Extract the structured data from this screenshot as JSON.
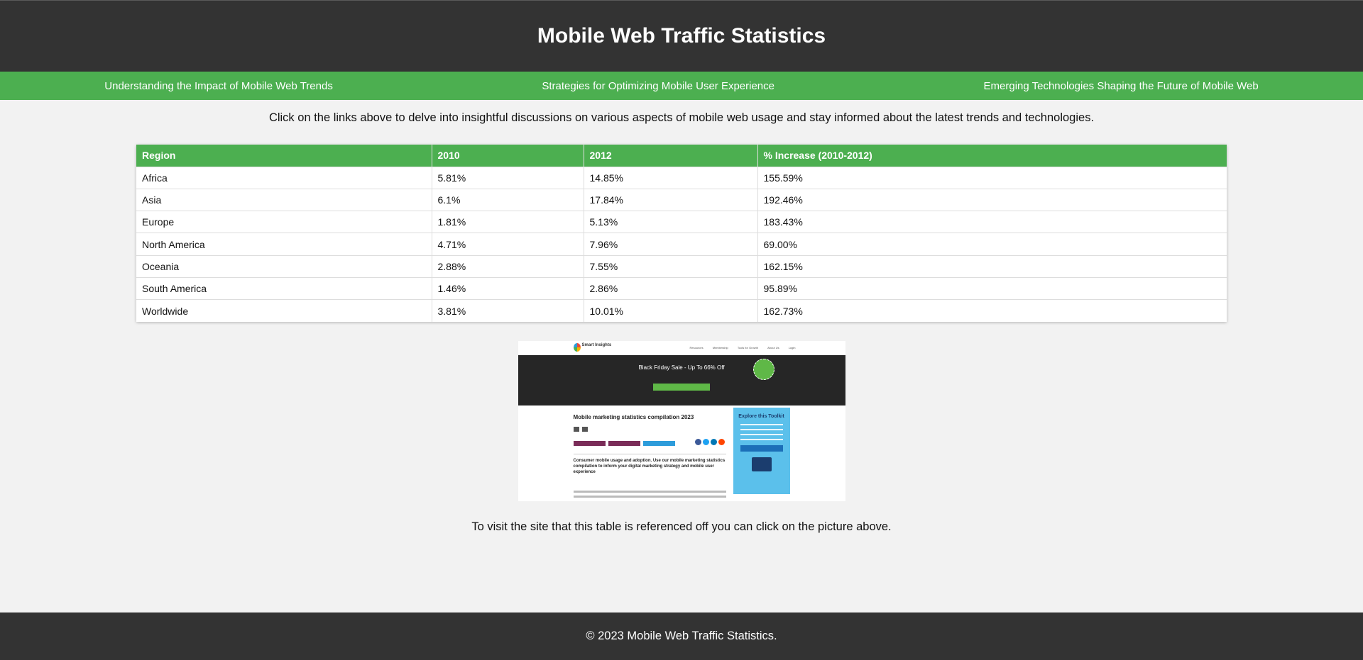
{
  "header": {
    "title": "Mobile Web Traffic Statistics"
  },
  "nav": {
    "links": [
      "Understanding the Impact of Mobile Web Trends",
      "Strategies for Optimizing Mobile User Experience",
      "Emerging Technologies Shaping the Future of Mobile Web"
    ]
  },
  "intro": "Click on the links above to delve into insightful discussions on various aspects of mobile web usage and stay informed about the latest trends and technologies.",
  "table": {
    "headers": [
      "Region",
      "2010",
      "2012",
      "% Increase (2010-2012)"
    ],
    "rows": [
      [
        "Africa",
        "5.81%",
        "14.85%",
        "155.59%"
      ],
      [
        "Asia",
        "6.1%",
        "17.84%",
        "192.46%"
      ],
      [
        "Europe",
        "1.81%",
        "5.13%",
        "183.43%"
      ],
      [
        "North America",
        "4.71%",
        "7.96%",
        "69.00%"
      ],
      [
        "Oceania",
        "2.88%",
        "7.55%",
        "162.15%"
      ],
      [
        "South America",
        "1.46%",
        "2.86%",
        "95.89%"
      ],
      [
        "Worldwide",
        "3.81%",
        "10.01%",
        "162.73%"
      ]
    ]
  },
  "thumbnail": {
    "logo_text": "Smart Insights",
    "nav_items": [
      "Resources",
      "Membership",
      "Tools for Growth",
      "About Us",
      "Login"
    ],
    "banner_title": "Black Friday Sale - Up To 66% Off",
    "article_title": "Mobile marketing statistics compilation 2023",
    "lead": "Consumer mobile usage and adoption. Use our mobile marketing statistics compilation to inform your digital marketing strategy and mobile user experience",
    "sidebar_title": "Explore this Toolkit"
  },
  "outro": "To visit the site that this table is referenced off you can click on the picture above.",
  "footer": {
    "text": "© 2023 Mobile Web Traffic Statistics."
  },
  "colors": {
    "header_bg": "#333333",
    "nav_bg": "#4caf50",
    "page_bg": "#f2f2f2",
    "table_header_bg": "#4caf50"
  }
}
